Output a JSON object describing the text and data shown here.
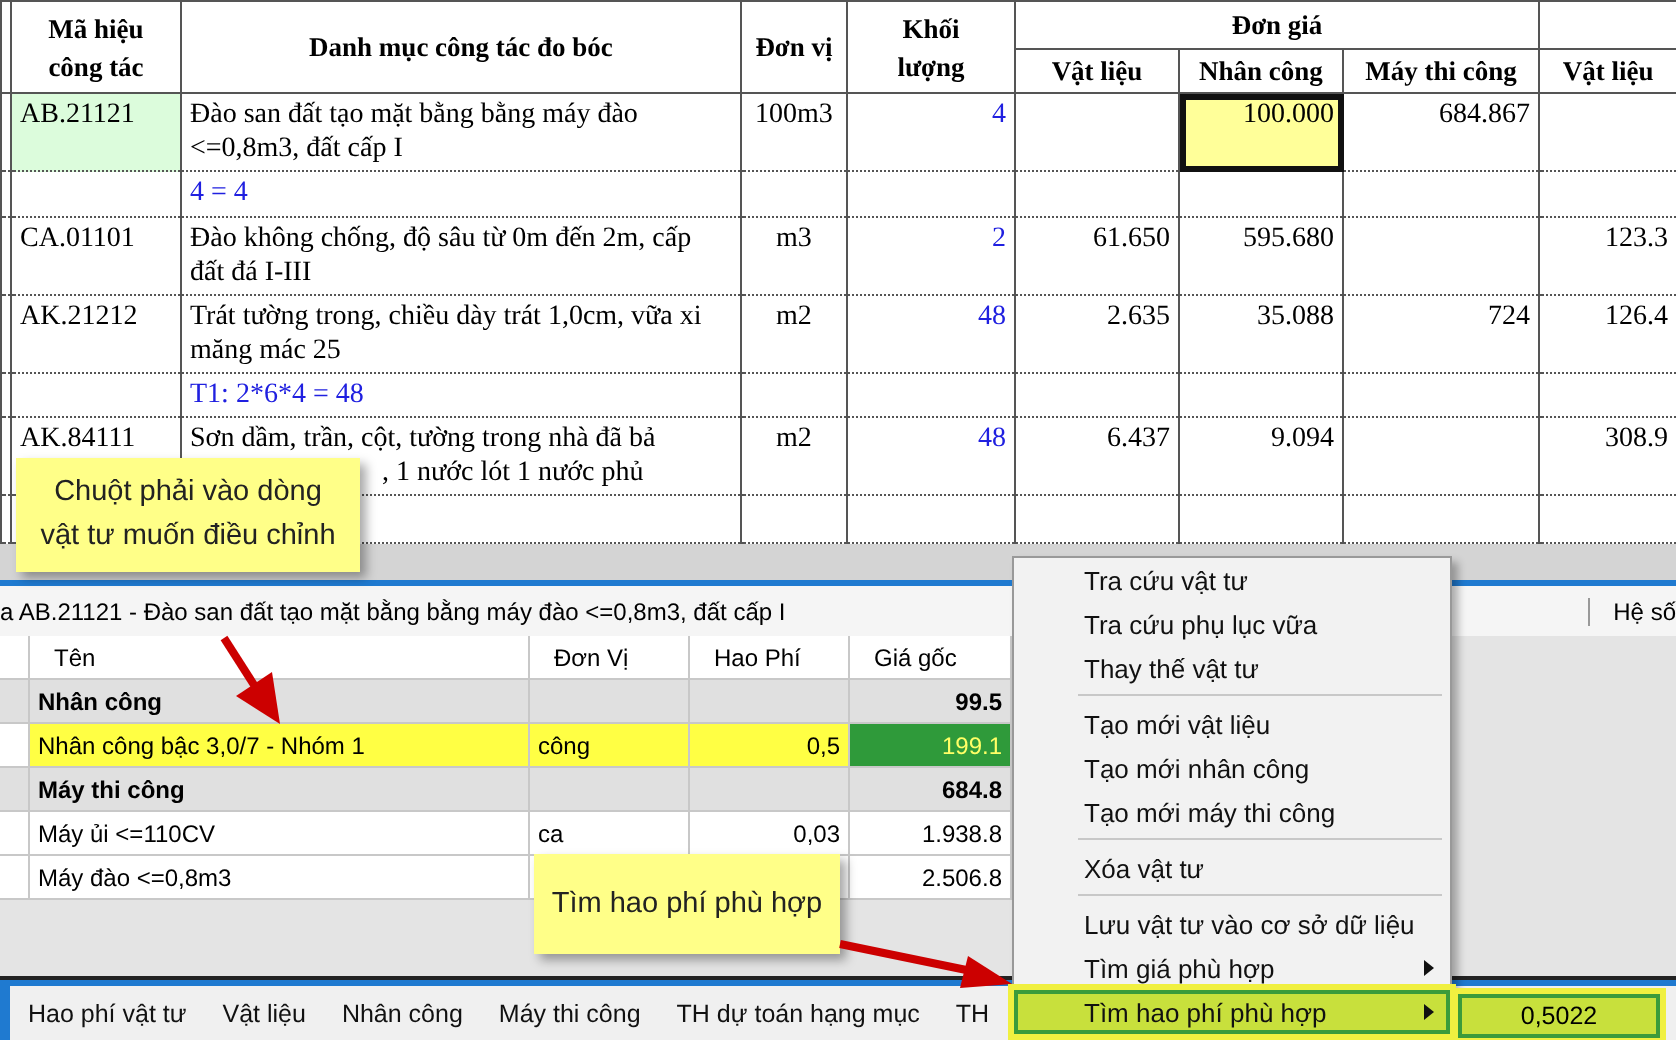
{
  "sheet": {
    "headers": {
      "code": "Mã hiệu công tác",
      "desc": "Danh mục công tác đo bóc",
      "unit": "Đơn vị",
      "qty": "Khối lượng",
      "group": "Đơn giá",
      "prices": [
        "Vật liệu",
        "Nhân công",
        "Máy thi công",
        "Vật liệu"
      ]
    },
    "rows": [
      {
        "kind": "item",
        "code": "AB.21121",
        "code_highlighted": true,
        "desc": "Đào san đất tạo mặt bằng bằng máy đào <=0,8m3, đất cấp I",
        "unit": "100m3",
        "qty": "4",
        "labor": {
          "text": "100.000",
          "selected": true
        },
        "machine": {
          "text": "684.867",
          "selected": false
        }
      },
      {
        "kind": "formula",
        "text": "4 = 4"
      },
      {
        "kind": "item",
        "code": "CA.01101",
        "code_highlighted": false,
        "desc": "Đào không chống, độ sâu từ 0m đến 2m, cấp đất đá I-III",
        "unit": "m3",
        "qty": "2",
        "material": {
          "text": "61.650",
          "selected": false
        },
        "labor": {
          "text": "595.680",
          "selected": false
        },
        "material_total": {
          "text": "123.3",
          "selected": false
        }
      },
      {
        "kind": "item",
        "code": "AK.21212",
        "code_highlighted": false,
        "desc": "Trát tường trong, chiều dày trát 1,0cm, vữa xi măng mác 25",
        "unit": "m2",
        "qty": "48",
        "material": {
          "text": "2.635",
          "selected": false
        },
        "labor": {
          "text": "35.088",
          "selected": false
        },
        "machine": {
          "text": "724",
          "selected": false
        },
        "material_total": {
          "text": "126.4",
          "selected": false
        }
      },
      {
        "kind": "formula",
        "text": "T1: 2*6*4 = 48"
      },
      {
        "kind": "item",
        "code": "AK.84111",
        "code_highlighted": false,
        "desc": "Sơn dầm, trần, cột, tường trong nhà đã bả",
        "desc_tail": ", 1 nước lót 1 nước phủ",
        "unit": "m2",
        "qty": "48",
        "material": {
          "text": "6.437",
          "selected": false
        },
        "labor": {
          "text": "9.094",
          "selected": false
        },
        "material_total": {
          "text": "308.9",
          "selected": false
        }
      },
      {
        "kind": "blank"
      }
    ]
  },
  "info_bar": {
    "caption": "a AB.21121 - Đào san đất tạo mặt bằng bằng máy đào <=0,8m3, đất cấp I",
    "right_label": "Hệ số"
  },
  "grid": {
    "columns": [
      "Tên",
      "Đơn Vị",
      "Hao Phí",
      "Giá gốc"
    ],
    "rows": [
      {
        "kind": "group",
        "name": "Nhân công",
        "price": "99.5"
      },
      {
        "kind": "item",
        "name": "Nhân công bậc 3,0/7 - Nhóm 1",
        "unit": "công",
        "amount": "0,5",
        "price": "199.1",
        "selected": true
      },
      {
        "kind": "group",
        "name": "Máy thi công",
        "price": "684.8"
      },
      {
        "kind": "item",
        "name": "Máy ủi <=110CV",
        "unit": "ca",
        "amount": "0,03",
        "price": "1.938.8",
        "selected": false
      },
      {
        "kind": "item",
        "name": "Máy đào <=0,8m3",
        "price": "2.506.8",
        "selected": false
      }
    ]
  },
  "tabs": [
    {
      "label": "Hao phí vật tư",
      "selected": false
    },
    {
      "label": "Vật liệu",
      "selected": false
    },
    {
      "label": "Nhân công",
      "selected": false
    },
    {
      "label": "Máy thi công",
      "selected": false
    },
    {
      "label": "TH dự toán hạng mục",
      "selected": false
    },
    {
      "label": "TH",
      "selected": false
    }
  ],
  "context_menu": {
    "items": [
      {
        "label": "Tra cứu vật tư",
        "separator_before": false,
        "submenu": false,
        "highlighted": false
      },
      {
        "label": "Tra cứu phụ lục vữa",
        "separator_before": false,
        "submenu": false,
        "highlighted": false
      },
      {
        "label": "Thay thế vật tư",
        "separator_before": false,
        "submenu": false,
        "highlighted": false
      },
      {
        "label": "Tạo mới vật liệu",
        "separator_before": true,
        "submenu": false,
        "highlighted": false
      },
      {
        "label": "Tạo mới nhân công",
        "separator_before": false,
        "submenu": false,
        "highlighted": false
      },
      {
        "label": "Tạo mới máy thi công",
        "separator_before": false,
        "submenu": false,
        "highlighted": false
      },
      {
        "label": "Xóa vật tư",
        "separator_before": true,
        "submenu": false,
        "highlighted": false
      },
      {
        "label": "Lưu vật tư vào cơ sở dữ liệu",
        "separator_before": true,
        "submenu": false,
        "highlighted": false
      },
      {
        "label": "Tìm giá phù hợp",
        "separator_before": false,
        "submenu": true,
        "highlighted": false
      },
      {
        "label": "Tìm hao phí phù hợp",
        "separator_before": false,
        "submenu": true,
        "highlighted": true
      }
    ],
    "submenu_value": "0,5022"
  },
  "callouts": [
    {
      "text": "Chuột phải vào dòng vật tư muốn điều chỉnh"
    },
    {
      "text": "Tìm hao phí phù hợp"
    }
  ]
}
